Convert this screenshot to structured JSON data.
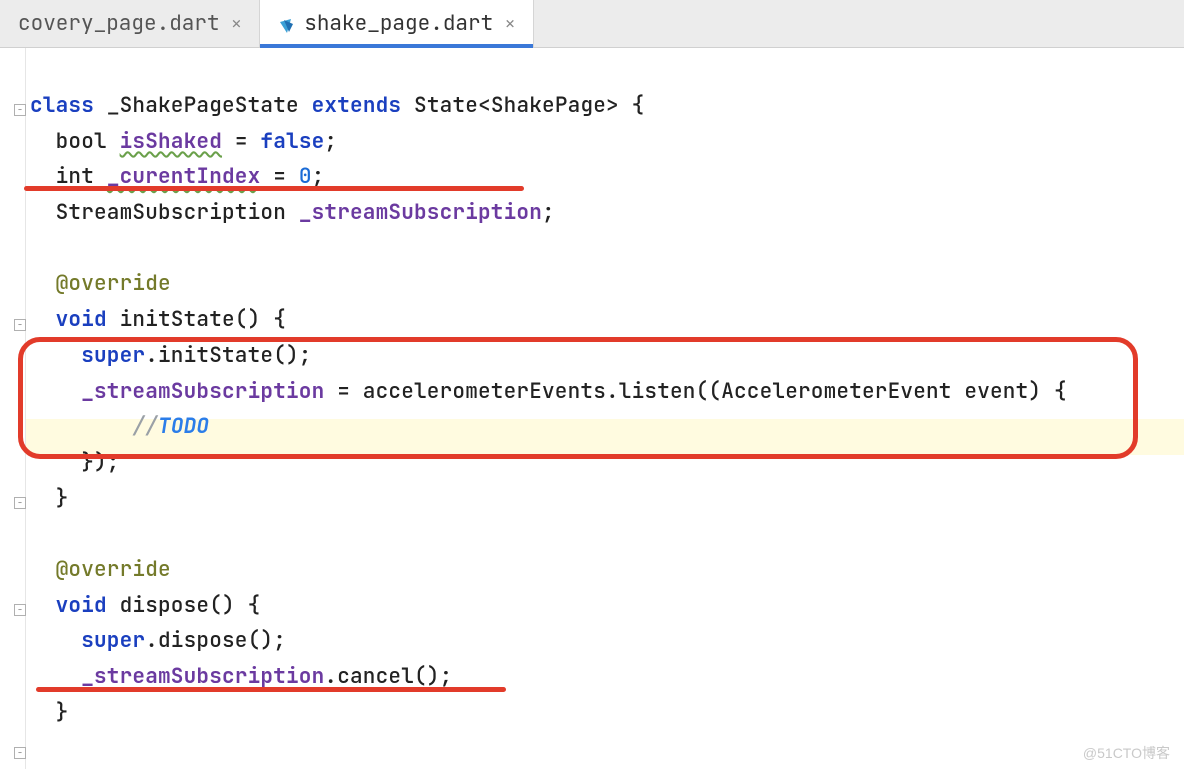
{
  "tabs": [
    {
      "label": "covery_page.dart",
      "active": false
    },
    {
      "label": "shake_page.dart",
      "active": true
    }
  ],
  "code": {
    "kw_class": "class",
    "class_name": "_ShakePageState",
    "kw_extends": "extends",
    "super_type": "State<ShakePage>",
    "brace_open": " {",
    "line2_type": "bool ",
    "line2_field": "isShaked",
    "line2_eq": " = ",
    "kw_false": "false",
    "semi": ";",
    "line3_type": "int ",
    "line3_field": "_curentIndex",
    "line3_eq": " = ",
    "line3_val": "0",
    "line4_type": "StreamSubscription ",
    "line4_field": "_streamSubscription",
    "override": "@override",
    "kw_void": "void",
    "initState_name": " initState() {",
    "kw_super": "super",
    "super_init": ".initState();",
    "listen_lhs": "_streamSubscription",
    "listen_eq_rhs": " = accelerometerEvents.listen((AccelerometerEvent event) {",
    "todo_slashes": "//",
    "todo_text": "TODO",
    "listen_close": "});",
    "brace_close": "}",
    "dispose_name": " dispose() {",
    "super_dispose": ".dispose();",
    "cancel_lhs": "_streamSubscription",
    "cancel_call": ".cancel();"
  },
  "watermark": "@51CTO博客"
}
